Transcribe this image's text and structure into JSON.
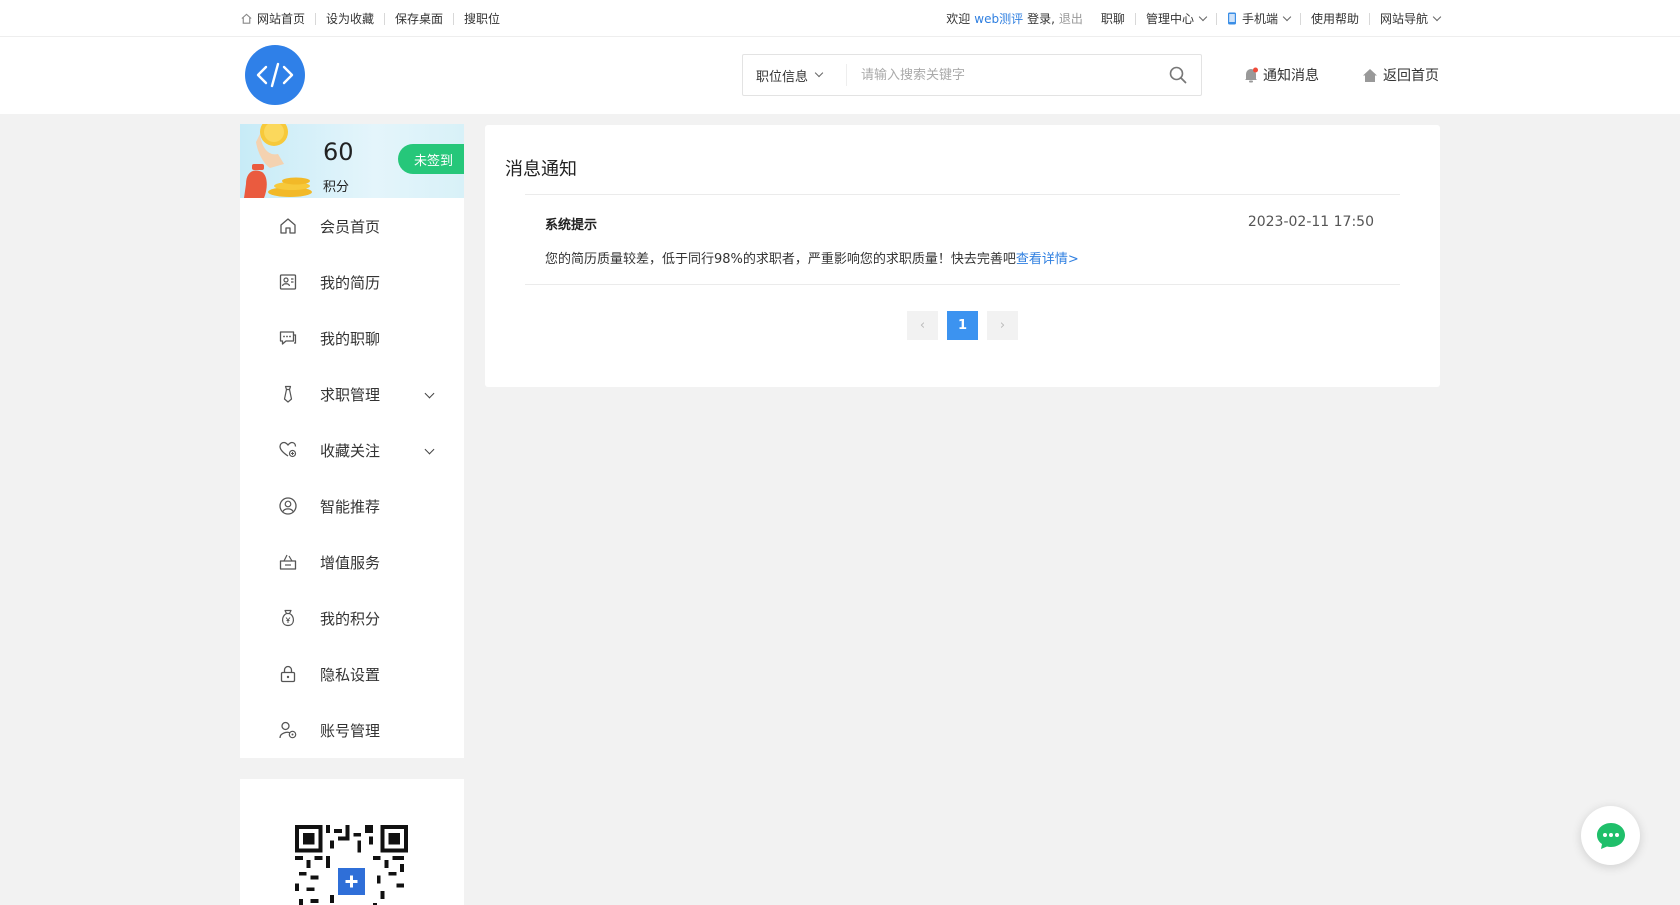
{
  "topbar": {
    "links": [
      "网站首页",
      "设为收藏",
      "保存桌面",
      "搜职位"
    ],
    "welcome_prefix": "欢迎",
    "username": "web测评",
    "login_text": "登录,",
    "logout": "退出",
    "zhiliao": "职聊",
    "admin_center": "管理中心",
    "mobile": "手机端",
    "help": "使用帮助",
    "site_nav": "网站导航"
  },
  "header": {
    "search_category": "职位信息",
    "search_placeholder": "请输入搜索关键字",
    "notify": "通知消息",
    "home": "返回首页"
  },
  "sidebar": {
    "points": "60",
    "points_label": "积分",
    "sign_button": "未签到",
    "menu": [
      {
        "label": "会员首页",
        "icon": "home-icon"
      },
      {
        "label": "我的简历",
        "icon": "resume-icon"
      },
      {
        "label": "我的职聊",
        "icon": "chat-icon"
      },
      {
        "label": "求职管理",
        "icon": "tie-icon",
        "expandable": true
      },
      {
        "label": "收藏关注",
        "icon": "heart-icon",
        "expandable": true
      },
      {
        "label": "智能推荐",
        "icon": "user-circle-icon"
      },
      {
        "label": "增值服务",
        "icon": "basket-icon"
      },
      {
        "label": "我的积分",
        "icon": "money-bag-icon"
      },
      {
        "label": "隐私设置",
        "icon": "lock-icon"
      },
      {
        "label": "账号管理",
        "icon": "account-settings-icon"
      }
    ]
  },
  "main": {
    "title": "消息通知",
    "messages": [
      {
        "title": "系统提示",
        "time": "2023-02-11 17:50",
        "body": "您的简历质量较差，低于同行98%的求职者，严重影响您的求职质量！快去完善吧",
        "link": "查看详情>"
      }
    ],
    "pagination": {
      "prev": "‹",
      "current": "1",
      "next": "›"
    }
  },
  "colors": {
    "brand_blue": "#2f80e8",
    "sign_green": "#26c77a",
    "link_blue": "#2f7fe0",
    "page_active": "#3c93f0"
  }
}
